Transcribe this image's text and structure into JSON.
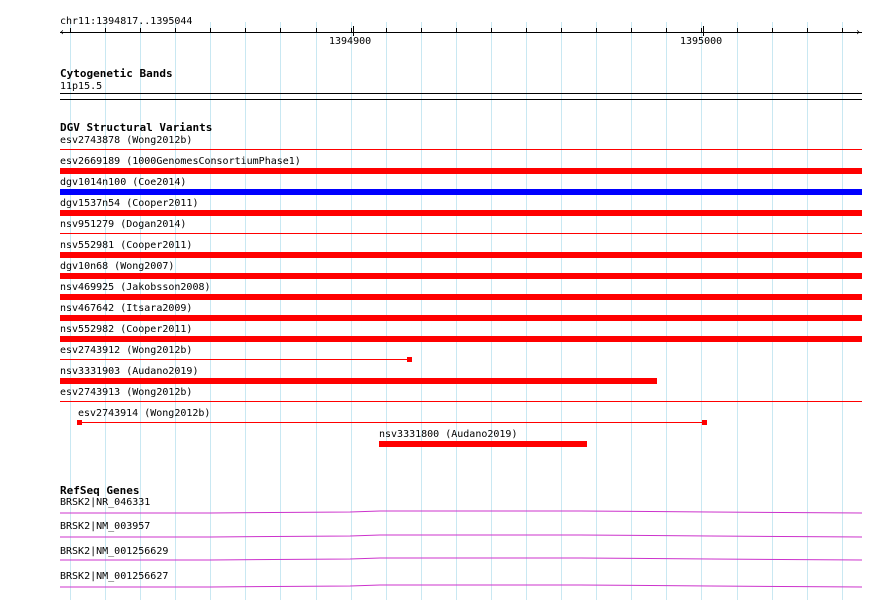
{
  "ruler": {
    "range_label": "chr11:1394817..1395044",
    "ticks": [
      "1394900",
      "1395000"
    ]
  },
  "cytoband": {
    "title": "Cytogenetic Bands",
    "band": "11p15.5"
  },
  "dgv": {
    "title": "DGV Structural Variants",
    "colors": {
      "loss": "#ff0000",
      "gain": "#0000ff"
    },
    "features": [
      {
        "label": "esv2743878 (Wong2012b)",
        "color": "#ff0000",
        "style": "thin"
      },
      {
        "label": "esv2669189 (1000GenomesConsortiumPhase1)",
        "color": "#ff0000",
        "style": "thick"
      },
      {
        "label": "dgv1014n100 (Coe2014)",
        "color": "#0000ff",
        "style": "thick"
      },
      {
        "label": "dgv1537n54 (Cooper2011)",
        "color": "#ff0000",
        "style": "thick"
      },
      {
        "label": "nsv951279 (Dogan2014)",
        "color": "#ff0000",
        "style": "thin"
      },
      {
        "label": "nsv552981 (Cooper2011)",
        "color": "#ff0000",
        "style": "thick"
      },
      {
        "label": "dgv10n68 (Wong2007)",
        "color": "#ff0000",
        "style": "thick"
      },
      {
        "label": "nsv469925 (Jakobsson2008)",
        "color": "#ff0000",
        "style": "thick"
      },
      {
        "label": "nsv467642 (Itsara2009)",
        "color": "#ff0000",
        "style": "thick"
      },
      {
        "label": "nsv552982 (Cooper2011)",
        "color": "#ff0000",
        "style": "thick"
      },
      {
        "label": "esv2743912 (Wong2012b)",
        "color": "#ff0000",
        "style": "thin-endcap"
      },
      {
        "label": "nsv3331903 (Audano2019)",
        "color": "#ff0000",
        "style": "thick"
      },
      {
        "label": "esv2743913 (Wong2012b)",
        "color": "#ff0000",
        "style": "thin"
      },
      {
        "label": "esv2743914 (Wong2012b)",
        "color": "#ff0000",
        "style": "thin-endcaps"
      },
      {
        "label": "nsv3331800 (Audano2019)",
        "color": "#ff0000",
        "style": "thick"
      }
    ]
  },
  "refseq": {
    "title": "RefSeq Genes",
    "color": "#cc33cc",
    "genes": [
      {
        "label": "BRSK2|NR_046331"
      },
      {
        "label": "BRSK2|NM_003957"
      },
      {
        "label": "BRSK2|NM_001256629"
      },
      {
        "label": "BRSK2|NM_001256627"
      }
    ]
  }
}
